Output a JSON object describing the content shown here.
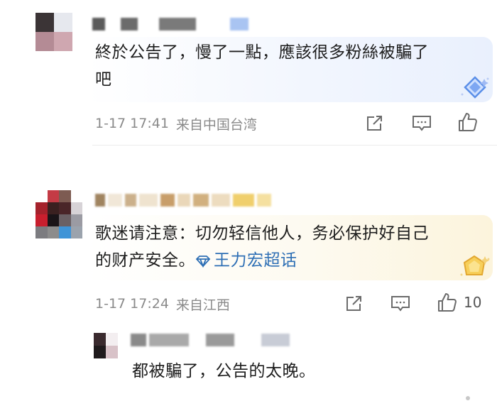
{
  "comments": [
    {
      "text_line1": "終於公告了，慢了一點，應該很多粉絲被騙了",
      "text_line2": "吧",
      "time": "1-17 17:41",
      "location": "来自中国台湾",
      "like_count": ""
    },
    {
      "text_line1": "歌迷请注意：切勿轻信他人，务必保护好自己",
      "text_line2_prefix": "的财产安全。",
      "topic": "王力宏超话",
      "time": "1-17 17:24",
      "location": "来自江西",
      "like_count": "10"
    }
  ],
  "reply": {
    "text": "都被騙了，公告的太晚。"
  },
  "colors": {
    "bubble1": "#eef3fd",
    "bubble2": "#fdf8e9",
    "meta": "#8a8a8a",
    "link": "#2e6fb5",
    "icon": "#6b6b6b"
  },
  "icons": [
    "share-icon",
    "comment-icon",
    "like-icon",
    "diamond-badge-icon",
    "gold-badge-icon",
    "topic-diamond-icon"
  ]
}
